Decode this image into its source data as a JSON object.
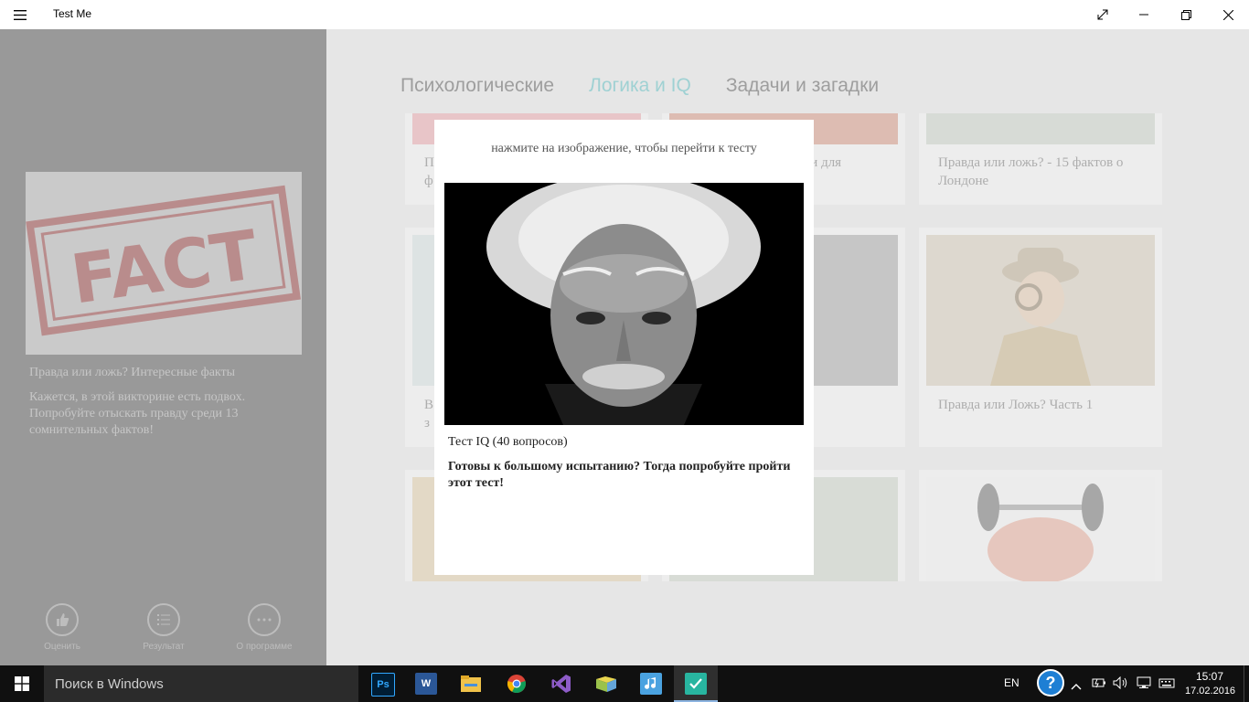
{
  "window": {
    "title": "Test Me",
    "icons": [
      "menu-icon",
      "fullscreen-icon",
      "minimize-icon",
      "restore-icon",
      "close-icon"
    ]
  },
  "sidebar": {
    "featured": {
      "stamp_text": "FACT",
      "title": "Правда или ложь? Интересные факты",
      "description": "Кажется, в этой викторине есть подвох. Попробуйте отыскать правду среди 13 сомнительных фактов!"
    },
    "actions": [
      {
        "label": "Оценить",
        "icon": "thumbs-up-icon"
      },
      {
        "label": "Результат",
        "icon": "list-icon"
      },
      {
        "label": "О программе",
        "icon": "more-icon"
      }
    ]
  },
  "main": {
    "tabs": [
      {
        "label": "Психологические",
        "active": false
      },
      {
        "label": "Логика и IQ",
        "active": true
      },
      {
        "label": "Задачи и загадки",
        "active": false
      }
    ],
    "cards": [
      {
        "text_fragment": "П\nф"
      },
      {
        "text_fragment": "ки для"
      },
      {
        "text": "Правда или ложь? - 15 фактов о Лондоне"
      },
      {
        "text_fragment": "В\nз"
      },
      {
        "text_fragment": ")"
      },
      {
        "text": "Правда или Ложь? Часть 1"
      },
      {
        "text_fragment": ""
      },
      {
        "text_fragment": ""
      },
      {
        "text_fragment": ""
      }
    ]
  },
  "modal": {
    "hint": "нажмите на изображение, чтобы перейти к тесту",
    "title": "Тест IQ (40 вопросов)",
    "description": "Готовы к большому испытанию? Тогда попробуйте пройти этот тест!"
  },
  "taskbar": {
    "search_placeholder": "Поиск в Windows",
    "apps": [
      {
        "icon": "photoshop-icon",
        "label": "Ps"
      },
      {
        "icon": "word-icon",
        "label": "W"
      },
      {
        "icon": "file-explorer-icon",
        "label": ""
      },
      {
        "icon": "chrome-icon",
        "label": ""
      },
      {
        "icon": "visual-studio-icon",
        "label": ""
      },
      {
        "icon": "folder-app-icon",
        "label": ""
      },
      {
        "icon": "music-app-icon",
        "label": ""
      },
      {
        "icon": "test-me-app-icon",
        "label": ""
      }
    ],
    "language": "EN",
    "time": "15:07",
    "date": "17.02.2016"
  },
  "colors": {
    "accent_tab": "#9fd1d3",
    "sidebar_bg": "#999999",
    "taskbar_bg": "#101010"
  }
}
